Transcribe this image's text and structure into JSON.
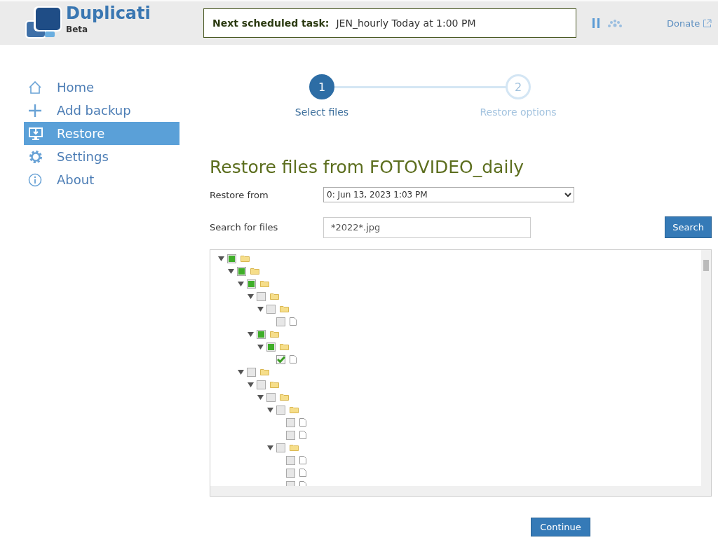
{
  "header": {
    "app_name": "Duplicati",
    "edition": "Beta",
    "task_label": "Next scheduled task:",
    "task_value": "JEN_hourly Today at 1:00 PM",
    "donate": "Donate"
  },
  "sidebar": {
    "items": [
      {
        "label": "Home",
        "selected": false
      },
      {
        "label": "Add backup",
        "selected": false
      },
      {
        "label": "Restore",
        "selected": true
      },
      {
        "label": "Settings",
        "selected": false
      },
      {
        "label": "About",
        "selected": false
      }
    ]
  },
  "steps": [
    {
      "number": "1",
      "label": "Select files",
      "selected": true
    },
    {
      "number": "2",
      "label": "Restore options",
      "selected": false
    }
  ],
  "title": "Restore files from FOTOVIDEO_daily",
  "restore_from": {
    "label": "Restore from",
    "value": "0: Jun 13, 2023 1:03 PM"
  },
  "search": {
    "label": "Search for files",
    "value": "*2022*.jpg",
    "button": "Search"
  },
  "tree": [
    {
      "kind": "folder",
      "checked": false,
      "partial": true,
      "expanded": true,
      "children": [
        {
          "kind": "folder",
          "checked": false,
          "partial": true,
          "expanded": true,
          "children": [
            {
              "kind": "folder",
              "checked": false,
              "partial": true,
              "expanded": true,
              "children": [
                {
                  "kind": "folder",
                  "checked": false,
                  "partial": false,
                  "expanded": true,
                  "children": [
                    {
                      "kind": "folder",
                      "checked": false,
                      "partial": false,
                      "expanded": true,
                      "children": [
                        {
                          "kind": "file",
                          "checked": false,
                          "partial": false
                        }
                      ]
                    }
                  ]
                },
                {
                  "kind": "folder",
                  "checked": false,
                  "partial": true,
                  "expanded": true,
                  "children": [
                    {
                      "kind": "folder",
                      "checked": false,
                      "partial": true,
                      "expanded": true,
                      "children": [
                        {
                          "kind": "file",
                          "checked": true
                        }
                      ]
                    }
                  ]
                }
              ]
            },
            {
              "kind": "folder",
              "checked": false,
              "partial": false,
              "expanded": true,
              "children": [
                {
                  "kind": "folder",
                  "checked": false,
                  "partial": false,
                  "expanded": true,
                  "children": [
                    {
                      "kind": "folder",
                      "checked": false,
                      "partial": false,
                      "expanded": true,
                      "children": [
                        {
                          "kind": "folder",
                          "checked": false,
                          "partial": false,
                          "expanded": true,
                          "children": [
                            {
                              "kind": "file",
                              "checked": false,
                              "partial": false
                            },
                            {
                              "kind": "file",
                              "checked": false,
                              "partial": false
                            }
                          ]
                        },
                        {
                          "kind": "folder",
                          "checked": false,
                          "partial": false,
                          "expanded": true,
                          "children": [
                            {
                              "kind": "file",
                              "checked": false,
                              "partial": false
                            },
                            {
                              "kind": "file",
                              "checked": false,
                              "partial": false
                            },
                            {
                              "kind": "file",
                              "checked": false,
                              "partial": false
                            }
                          ]
                        }
                      ]
                    }
                  ]
                }
              ]
            }
          ]
        }
      ]
    }
  ],
  "continue_button": "Continue"
}
